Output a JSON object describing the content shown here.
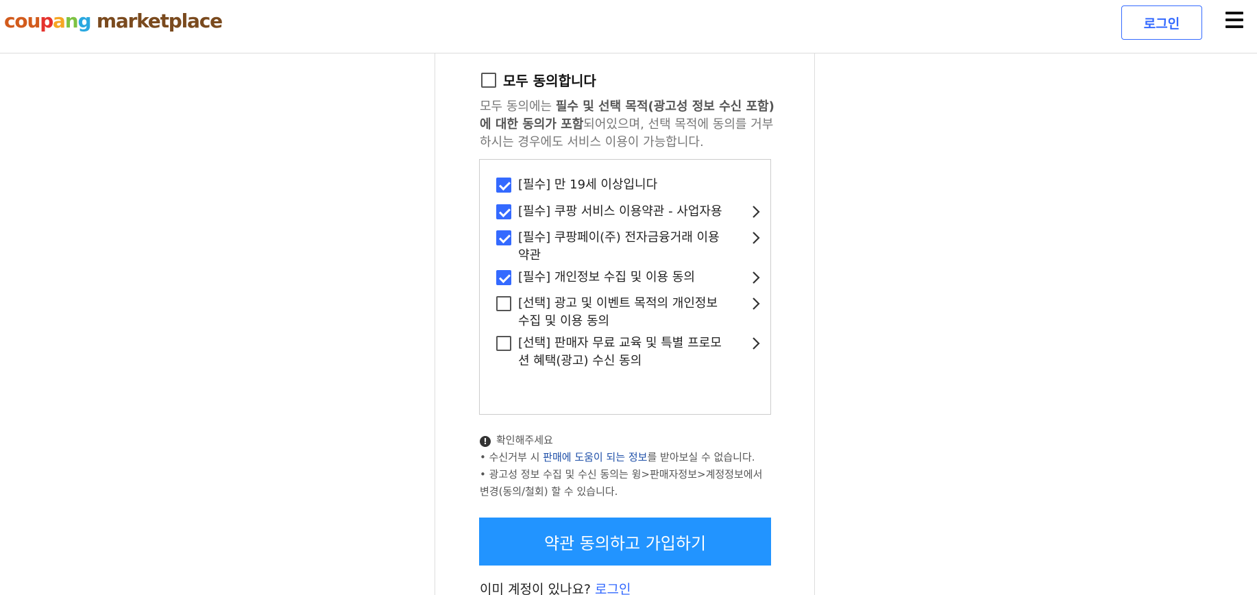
{
  "header": {
    "logo": [
      {
        "text": "c",
        "color": "#d25b1c"
      },
      {
        "text": "o",
        "color": "#d25b1c"
      },
      {
        "text": "u",
        "color": "#d25b1c"
      },
      {
        "text": "p",
        "color": "#e5322d"
      },
      {
        "text": "a",
        "color": "#f6a623"
      },
      {
        "text": "n",
        "color": "#7dc242"
      },
      {
        "text": "g",
        "color": "#2aa8e0"
      },
      {
        "text": " marketplace",
        "color": "#7a4a1e"
      }
    ],
    "login_label": "로그인",
    "menu_icon": "hamburger-icon"
  },
  "agree_all": {
    "label": "모두 동의합니다",
    "checked": false
  },
  "description": {
    "part1": "모두 동의에는 ",
    "bold": "필수 및 선택 목적(광고성 정보 수신 포함)에 대한 동의가 포함",
    "part2": "되어있으며, 선택 목적에 동의를 거부하시는 경우에도 서비스 이용이 가능합니다."
  },
  "terms": [
    {
      "label": "[필수] 만 19세 이상입니다",
      "checked": true,
      "has_link": false
    },
    {
      "label": "[필수] 쿠팡 서비스 이용약관 - 사업자용",
      "checked": true,
      "has_link": true
    },
    {
      "label": "[필수] 쿠팡페이(주) 전자금융거래 이용약관",
      "checked": true,
      "has_link": true
    },
    {
      "label": "[필수] 개인정보 수집 및 이용 동의",
      "checked": true,
      "has_link": true
    },
    {
      "label": "[선택] 광고 및 이벤트 목적의 개인정보 수집 및 이용 동의",
      "checked": false,
      "has_link": true
    },
    {
      "label": "[선택] 판매자 무료 교육 및 특별 프로모션 혜택(광고) 수신 동의",
      "checked": false,
      "has_link": true
    }
  ],
  "notice": {
    "title": "확인해주세요",
    "line1_pre": "• 수신거부 시 ",
    "line1_hl": "판매에 도움이 되는 정보",
    "line1_post": "를 받아보실 수 없습니다.",
    "line2": "• 광고성 정보 수집 및 수신 동의는 윙>판매자정보>계정정보에서 변경(동의/철회) 할 수 있습니다."
  },
  "submit_label": "약관 동의하고 가입하기",
  "already": {
    "text": "이미 계정이 있나요? ",
    "link": "로그인"
  },
  "colors": {
    "accent": "#346aff",
    "button": "#2294ff"
  }
}
